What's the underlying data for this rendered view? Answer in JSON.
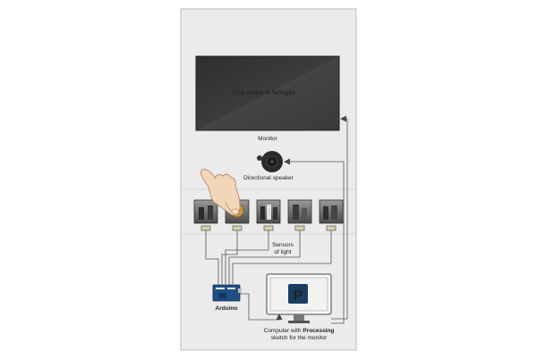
{
  "monitor": {
    "screen_text": "Una storia di famiglia ...",
    "label": "Monitor"
  },
  "speaker": {
    "label": "Directional speaker"
  },
  "sensors": {
    "label_line1": "Sensors",
    "label_line2": "of light",
    "photo_count": 5
  },
  "arduino": {
    "label": "Arduino",
    "brand_color": "#1e4f86"
  },
  "computer": {
    "label_prefix": "Computer with ",
    "label_bold": "Processing",
    "label_line2": "sketch for the monitor",
    "logo_letter": "P",
    "logo_color": "#1c3d63"
  },
  "colors": {
    "panel": "#ebebeb",
    "screen": "#3a3a3a",
    "wire": "#555555"
  }
}
